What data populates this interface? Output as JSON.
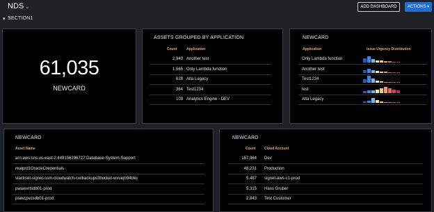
{
  "header": {
    "title": "NDS",
    "add_dashboard": "ADD DASHBOARD",
    "actions": "ACTIONS"
  },
  "section": {
    "label": "SECTION1"
  },
  "card1": {
    "value": "61,035",
    "label": "NEWCARD"
  },
  "card2": {
    "title": "ASSETS GROUPED BY APPLICATION",
    "col_count": "Count",
    "col_app": "Application",
    "rows": [
      {
        "count": "2,940",
        "app": "Another test"
      },
      {
        "count": "1,565",
        "app": "Only Lambda function"
      },
      {
        "count": "628",
        "app": "Alta Legacy"
      },
      {
        "count": "364",
        "app": "Test1234"
      },
      {
        "count": "103",
        "app": "Analytics Engine - DEV"
      }
    ]
  },
  "card3": {
    "title": "NEWCARD",
    "col_app": "Application",
    "col_dist": "Issue Urgency Distribution",
    "rows": [
      {
        "app": "Only Lambda function",
        "bars": [
          0.6,
          0.9,
          0.5,
          0.3,
          0.25,
          0.2,
          0.15,
          0.1,
          0.08
        ]
      },
      {
        "app": "Another test",
        "bars": [
          0.35,
          0.55,
          0.4,
          0.3,
          0.2,
          0.15,
          0.12,
          0.1,
          0.08
        ]
      },
      {
        "app": "Test1234",
        "bars": [
          0.5,
          0.95,
          0.6,
          0.3,
          0.2,
          0.1,
          0.08,
          0.06,
          0.05
        ]
      },
      {
        "app": "test",
        "bars": [
          0.3,
          0.4,
          0.35,
          0.5,
          0.7,
          0.9,
          0.7,
          0.5,
          0.4
        ]
      },
      {
        "app": "Alta Legacy",
        "bars": [
          0.15,
          0.3,
          0.7,
          0.4,
          0.2,
          0.1,
          0.08,
          0.05,
          0.04
        ]
      }
    ],
    "bar_colors": [
      "#1f5fbf",
      "#3e86e0",
      "#79b3f2",
      "#f2e6a0",
      "#f2c98a",
      "#ee9b6a",
      "#e46d5d",
      "#c74a5f",
      "#9c3a6a"
    ]
  },
  "card4": {
    "title": "NEWCARD",
    "col_name": "Asset Name",
    "rows": [
      "arn:aws:sns:us-east-2:449156296727:Database-System-Support",
      "realprd1OracleCredentials",
      "stackset-signet-ssm-cloudwatch-cwlbackups3bucket-wvuejb94blej",
      "pwawvrtsdb01-prod",
      "plawcpvcsdb01-prod"
    ]
  },
  "card5": {
    "title": "NEWCARD",
    "col_count": "Count",
    "col_account": "Cloud Account",
    "rows": [
      {
        "count": "157,964",
        "account": "Dev"
      },
      {
        "count": "48,231",
        "account": "Production"
      },
      {
        "count": "5,487",
        "account": "signet-aws-c1-prod"
      },
      {
        "count": "5,315",
        "account": "Hans Gruber"
      },
      {
        "count": "2,843",
        "account": "Test Customer"
      }
    ]
  }
}
